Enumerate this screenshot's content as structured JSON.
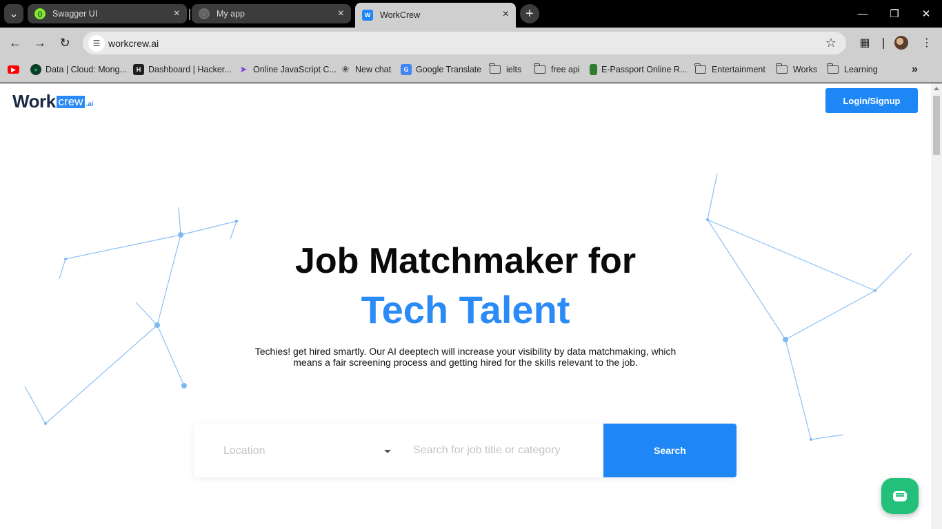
{
  "browser": {
    "tabs": [
      {
        "title": "Swagger UI",
        "icon": "swagger-icon"
      },
      {
        "title": "My app",
        "icon": "globe-icon"
      },
      {
        "title": "WorkCrew",
        "icon": "workcrew-icon",
        "active": true
      }
    ],
    "url": "workcrew.ai",
    "bookmarks": [
      {
        "label": "",
        "icon": "youtube-icon"
      },
      {
        "label": "Data | Cloud: Mong...",
        "icon": "mongodb-icon"
      },
      {
        "label": "Dashboard | Hacker...",
        "icon": "hackerrank-icon"
      },
      {
        "label": "Online JavaScript C...",
        "icon": "javascript-icon"
      },
      {
        "label": "New chat",
        "icon": "chatgpt-icon"
      },
      {
        "label": "Google Translate",
        "icon": "translate-icon"
      },
      {
        "label": "ielts",
        "icon": "folder-icon"
      },
      {
        "label": "free api",
        "icon": "folder-icon"
      },
      {
        "label": "E-Passport Online R...",
        "icon": "passport-icon"
      },
      {
        "label": "Entertainment",
        "icon": "folder-icon"
      },
      {
        "label": "Works",
        "icon": "folder-icon"
      },
      {
        "label": "Learning",
        "icon": "folder-icon"
      }
    ]
  },
  "site": {
    "logo": {
      "work": "Work",
      "crew": "crew",
      "ai": ".ai"
    },
    "login_label": "Login/Signup",
    "hero": {
      "title_line1": "Job Matchmaker for",
      "title_line2": "Tech Talent",
      "description": "Techies! get hired smartly. Our AI deeptech will increase your visibility by data matchmaking, which means a fair screening process and getting hired for the skills relevant to the job."
    },
    "search": {
      "location_placeholder": "Location",
      "job_placeholder": "Search for job title or category",
      "button_label": "Search"
    }
  },
  "colors": {
    "brand_blue": "#1f86f5",
    "logo_dark": "#1b2a44",
    "chat_green": "#22c07a",
    "network_line": "#8cc0f5"
  }
}
